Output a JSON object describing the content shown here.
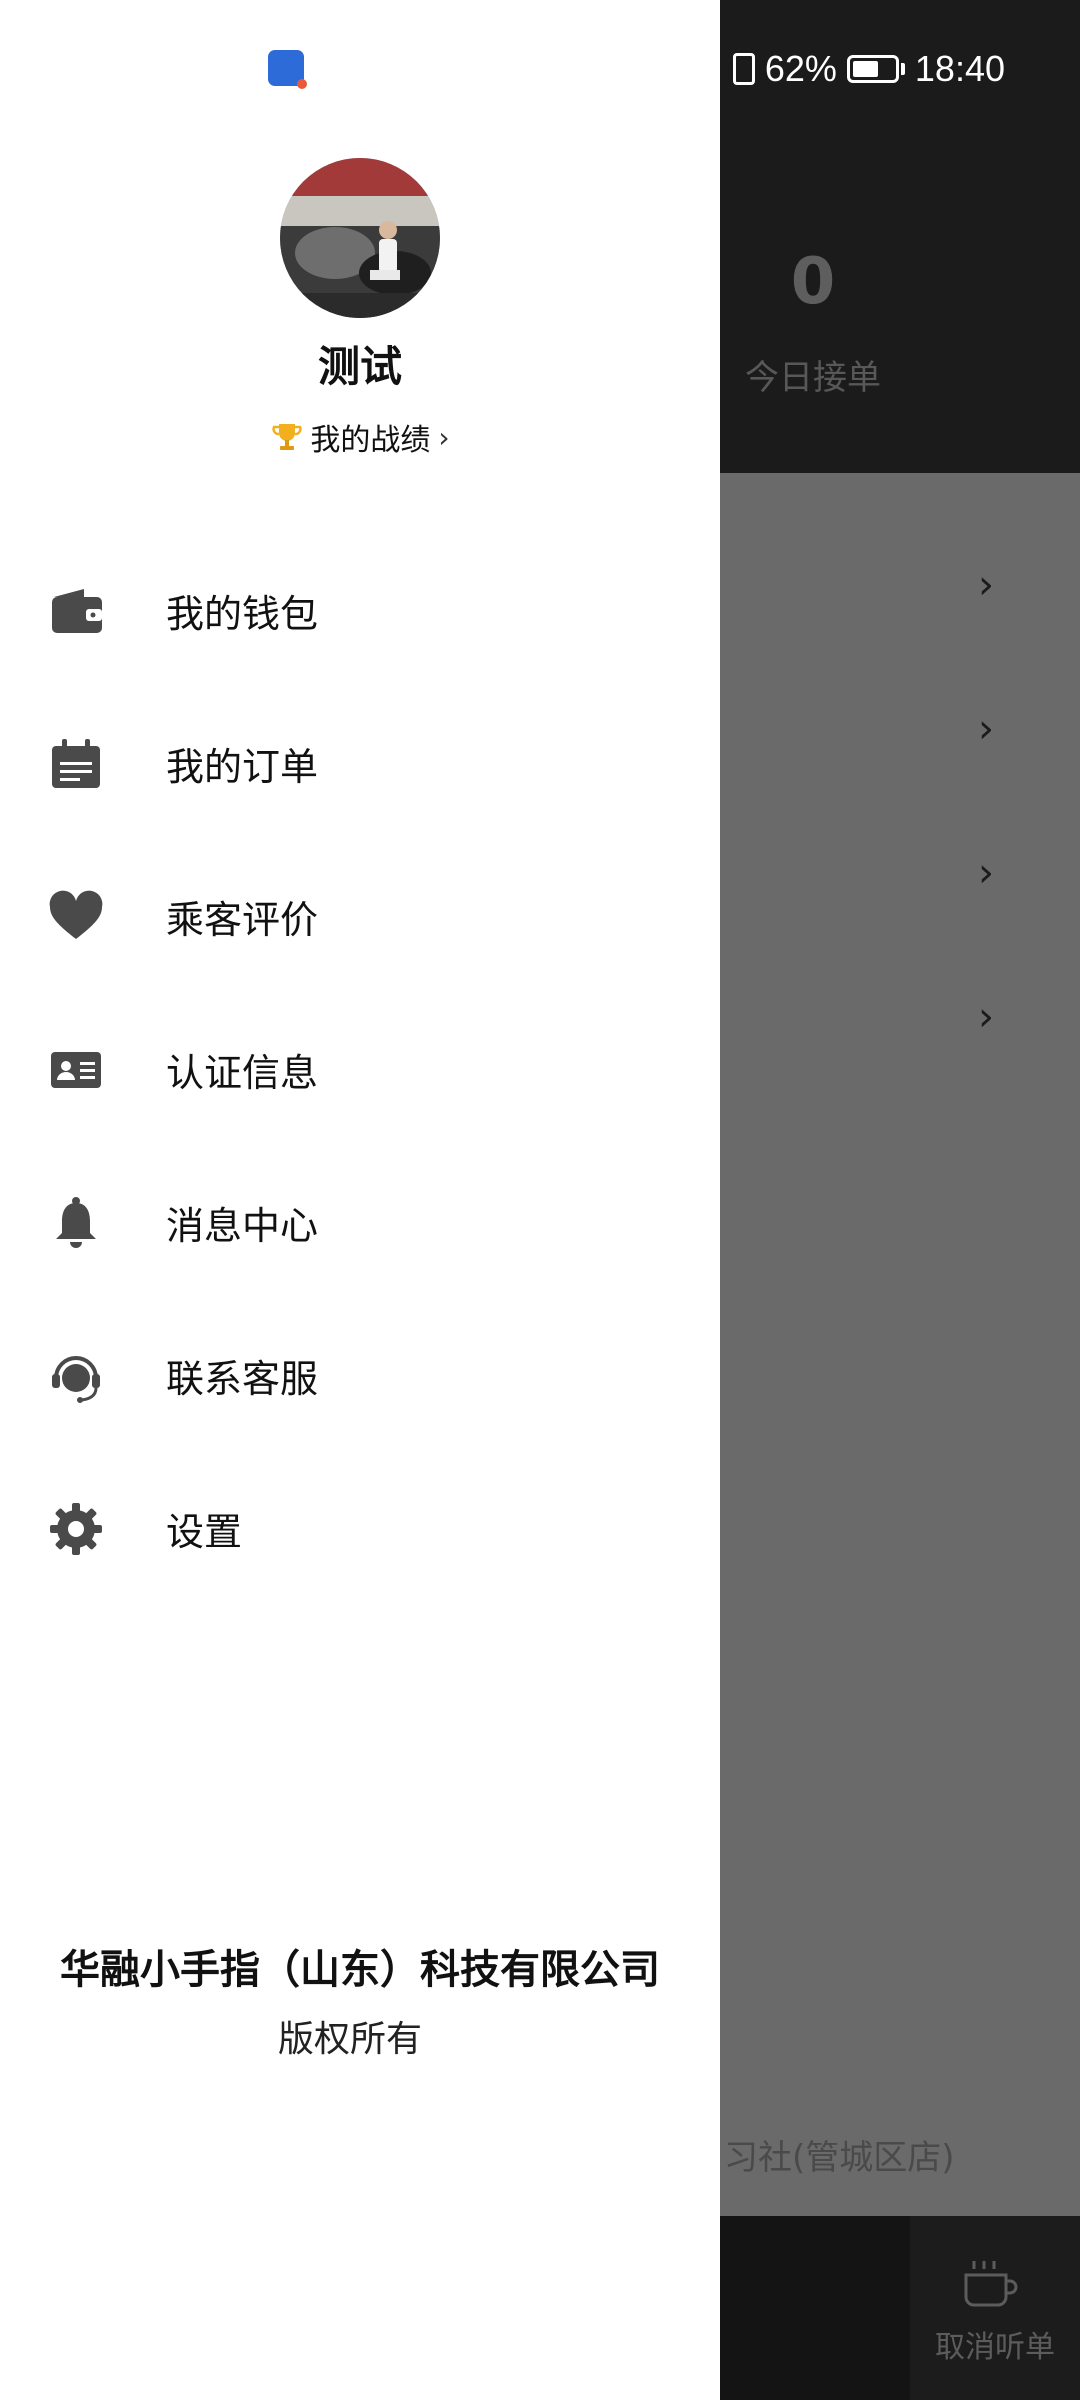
{
  "status_bar": {
    "battery": "62%",
    "time": "18:40"
  },
  "background": {
    "today_count": "0",
    "today_label": "今日接单",
    "shop_text": "自习社(管城区店)",
    "cancel_label": "取消听单"
  },
  "drawer": {
    "user_name": "测试",
    "record_label": "我的战绩",
    "menu": [
      {
        "label": "我的钱包",
        "icon": "wallet-icon"
      },
      {
        "label": "我的订单",
        "icon": "calendar-icon"
      },
      {
        "label": "乘客评价",
        "icon": "heart-icon"
      },
      {
        "label": "认证信息",
        "icon": "id-card-icon"
      },
      {
        "label": "消息中心",
        "icon": "bell-icon"
      },
      {
        "label": "联系客服",
        "icon": "headset-icon"
      },
      {
        "label": "设置",
        "icon": "gear-icon"
      }
    ],
    "company": "华融小手指（山东）科技有限公司",
    "rights": "版权所有"
  },
  "colors": {
    "icon_gray": "#4a4a4a",
    "overlay": "#6a6a6a",
    "dark": "#1b1b1b"
  }
}
